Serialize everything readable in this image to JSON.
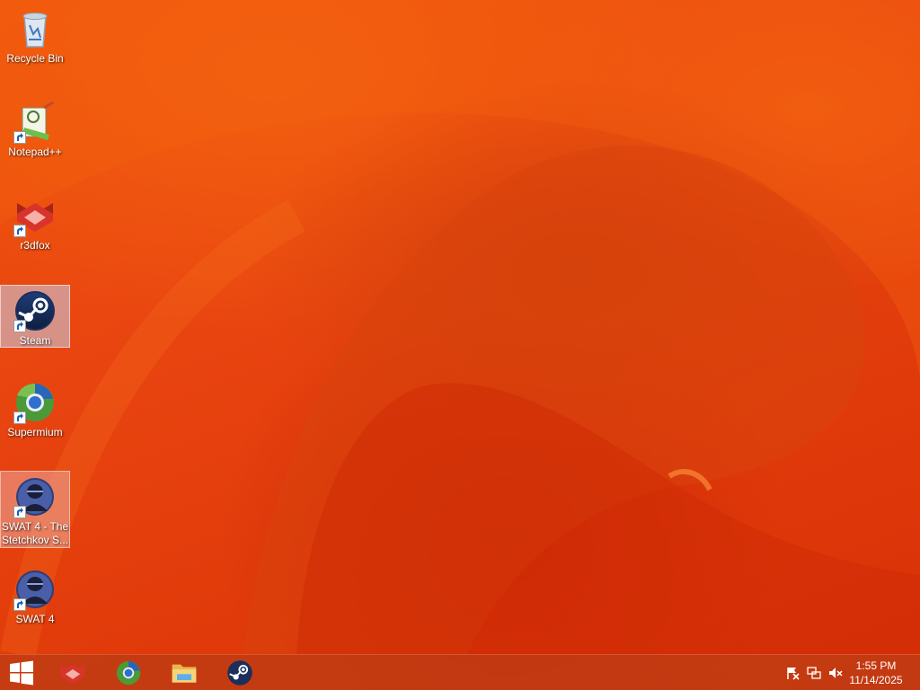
{
  "desktop": {
    "icons": [
      {
        "label": "Recycle Bin",
        "icon": "recycle-bin-icon"
      },
      {
        "label": "Notepad++",
        "icon": "notepad-plus-plus-icon"
      },
      {
        "label": "r3dfox",
        "icon": "r3dfox-icon"
      },
      {
        "label": "Steam",
        "icon": "steam-icon",
        "selected": true
      },
      {
        "label": "Supermium",
        "icon": "supermium-icon"
      },
      {
        "label": "SWAT 4 - The Stetchkov S...",
        "icon": "swat4-icon",
        "selected": true
      },
      {
        "label": "SWAT 4",
        "icon": "swat4-icon"
      }
    ]
  },
  "taskbar": {
    "start_icon": "windows-logo-icon",
    "pinned": [
      {
        "name": "r3dfox",
        "icon": "r3dfox-icon"
      },
      {
        "name": "Supermium",
        "icon": "supermium-icon"
      },
      {
        "name": "File Explorer",
        "icon": "file-explorer-icon"
      },
      {
        "name": "Steam",
        "icon": "steam-icon"
      }
    ],
    "tray": {
      "icons": [
        "action-center-flag-icon",
        "network-icon",
        "volume-muted-icon"
      ],
      "time": "1:55 PM",
      "date": "11/14/2025"
    }
  }
}
